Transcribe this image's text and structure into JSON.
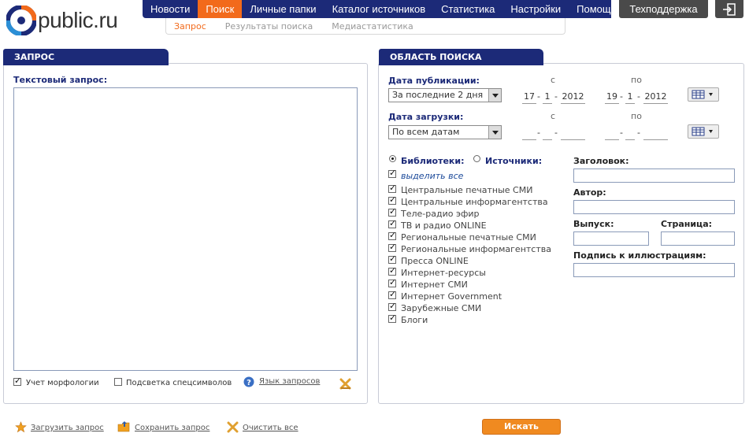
{
  "logo": {
    "text": "public.ru"
  },
  "topnav": {
    "items": [
      {
        "label": "Новости",
        "active": false
      },
      {
        "label": "Поиск",
        "active": true
      },
      {
        "label": "Личные папки",
        "active": false
      },
      {
        "label": "Каталог источников",
        "active": false
      },
      {
        "label": "Статистика",
        "active": false
      },
      {
        "label": "Настройки",
        "active": false
      },
      {
        "label": "Помощь",
        "active": false
      }
    ],
    "support": "Техподдержка",
    "exit_icon": "exit-icon"
  },
  "subnav": {
    "items": [
      {
        "label": "Запрос",
        "active": true
      },
      {
        "label": "Результаты поиска",
        "active": false
      },
      {
        "label": "Медиастатистика",
        "active": false
      }
    ]
  },
  "query_panel": {
    "tab": "ЗАПРОС",
    "text_label": "Текстовый запрос:",
    "text_value": "",
    "options": {
      "morphology": {
        "label": "Учет морфологии",
        "checked": true
      },
      "highlight": {
        "label": "Подсветка спецсимволов",
        "checked": false
      },
      "query_language": "Язык запросов"
    }
  },
  "scope_panel": {
    "tab": "ОБЛАСТЬ ПОИСКА",
    "pub_date": {
      "label": "Дата публикации:",
      "select": "За последние 2 дня",
      "from_label": "с",
      "to_label": "по",
      "from": {
        "d": "17",
        "m": "1",
        "y": "2012"
      },
      "to": {
        "d": "19",
        "m": "1",
        "y": "2012"
      }
    },
    "load_date": {
      "label": "Дата загрузки:",
      "select": "По всем датам",
      "from_label": "с",
      "to_label": "по"
    },
    "libraries_label": "Библиотеки:",
    "sources_label": "Источники:",
    "libraries_selected": true,
    "select_all": "выделить все",
    "sources": [
      "Центральные печатные СМИ",
      "Центральные информагентства",
      "Теле-радио эфир",
      "ТВ и радио ONLINE",
      "Региональные печатные СМИ",
      "Региональные информагентства",
      "Пресса ONLINE",
      "Интернет-ресурсы",
      "Интернет СМИ",
      "Интернет Government",
      "Зарубежные СМИ",
      "Блоги"
    ],
    "fields": {
      "title": "Заголовок:",
      "author": "Автор:",
      "issue": "Выпуск:",
      "page": "Страница:",
      "caption": "Подпись к иллюстрациям:"
    }
  },
  "footer": {
    "load": "Загрузить запрос",
    "save": "Сохранить запрос",
    "clear": "Очистить все",
    "search": "Искать"
  },
  "colors": {
    "nav": "#1c2a78",
    "accent": "#f26a1b",
    "button": "#f08a20"
  }
}
